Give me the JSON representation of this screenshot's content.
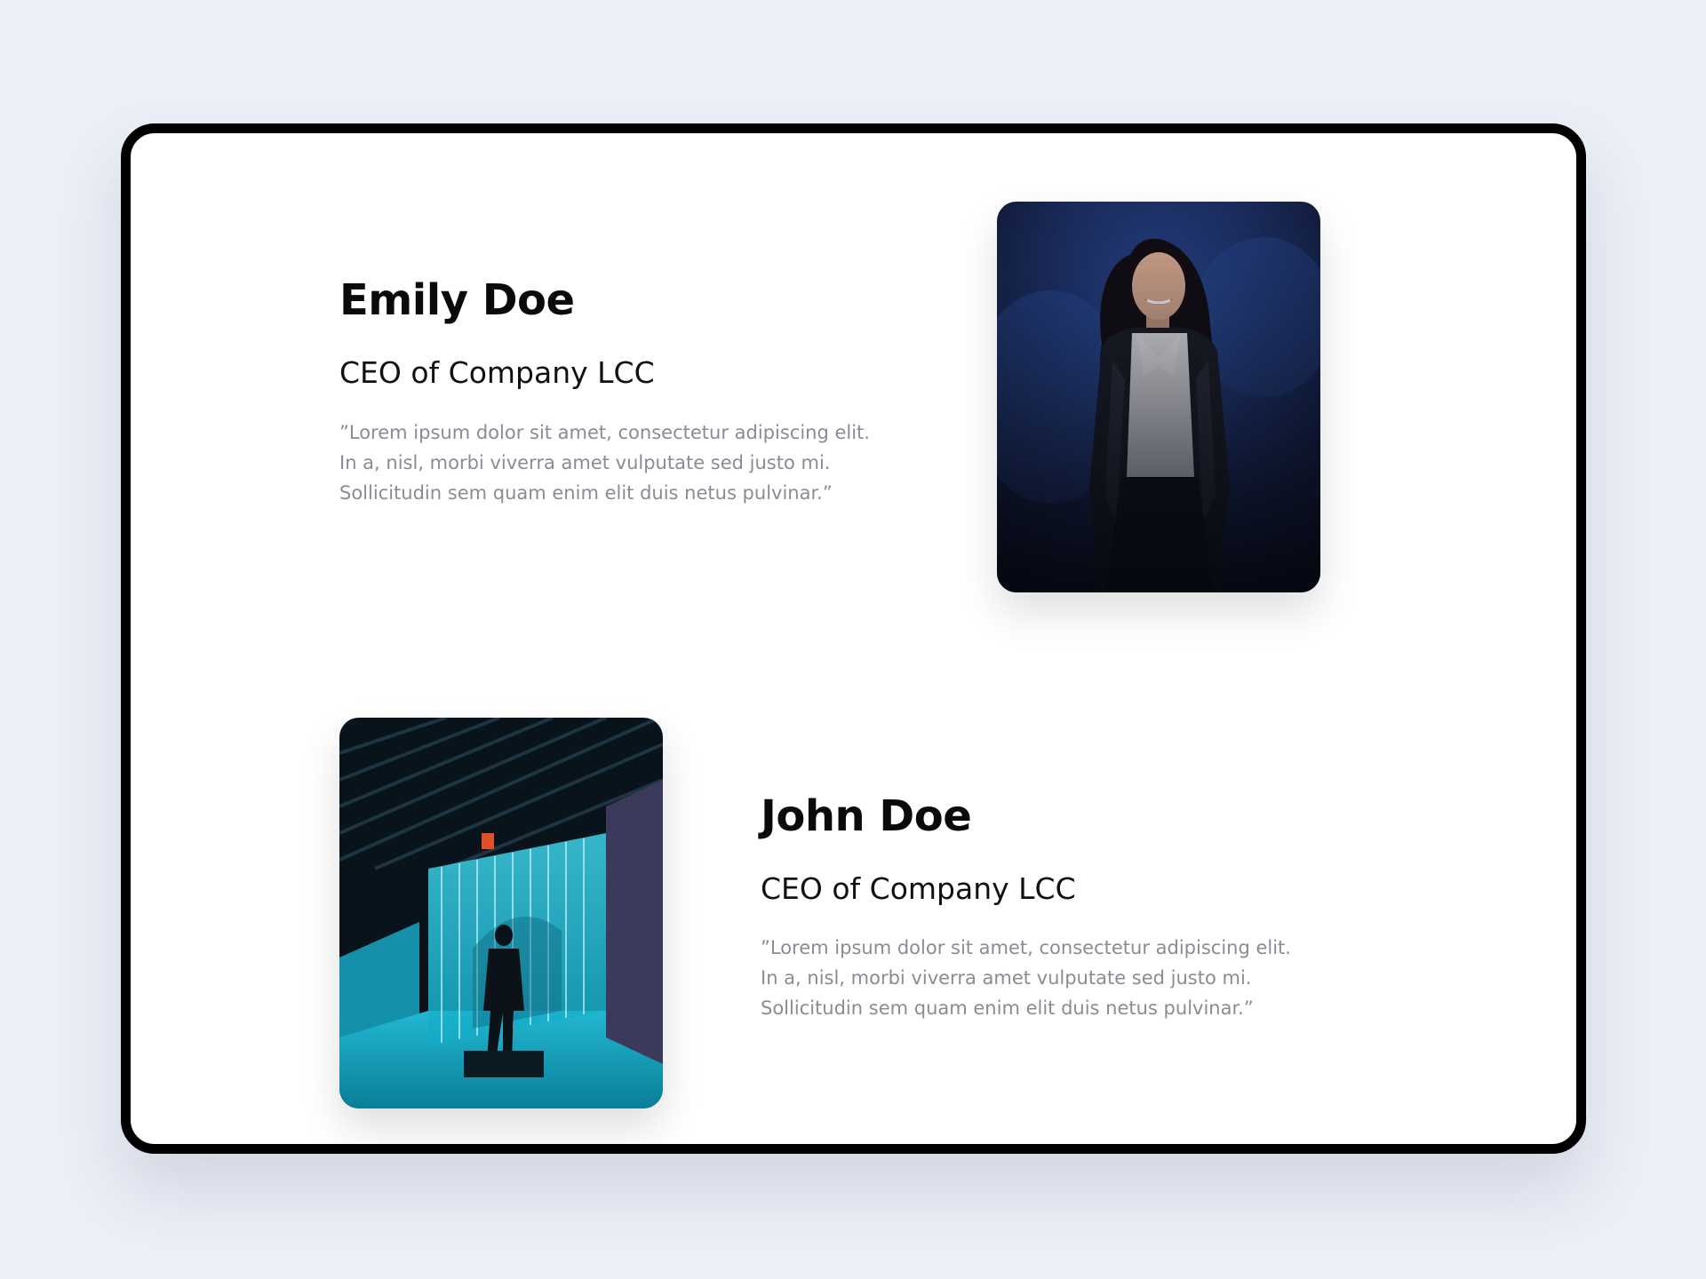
{
  "testimonials": [
    {
      "name": "Emily Doe",
      "role": "CEO of Company LCC",
      "quote_lines": [
        "”Lorem ipsum dolor sit amet, consectetur adipiscing elit.",
        "In a, nisl, morbi viverra amet vulputate sed justo mi.",
        "Sollicitudin sem quam enim elit duis netus pulvinar.”"
      ]
    },
    {
      "name": "John Doe",
      "role": "CEO of Company LCC",
      "quote_lines": [
        "”Lorem ipsum dolor sit amet, consectetur adipiscing elit.",
        "In a, nisl, morbi viverra amet vulputate sed justo mi.",
        "Sollicitudin sem quam enim elit duis netus pulvinar.”"
      ]
    }
  ],
  "colors": {
    "page_background": "#ebeff7",
    "card_background": "#ffffff",
    "frame_border": "#000000",
    "name_text": "#0a0a0a",
    "quote_text": "#8b8b96"
  }
}
